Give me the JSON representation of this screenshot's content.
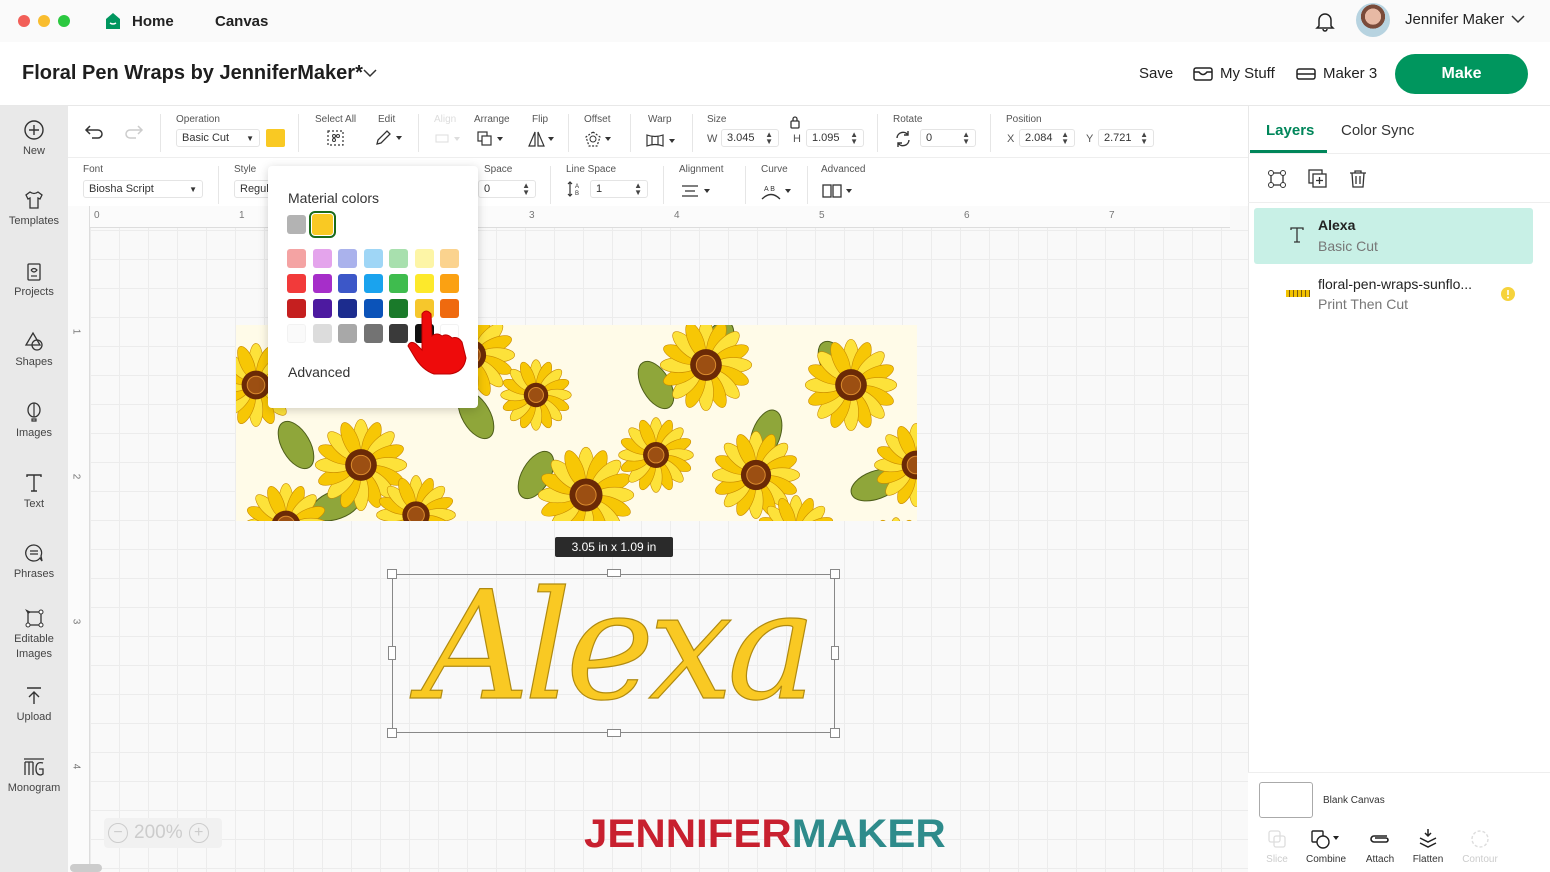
{
  "window": {
    "nav": {
      "home": "Home",
      "canvas": "Canvas"
    },
    "user": {
      "name": "Jennifer Maker"
    }
  },
  "header": {
    "project_title": "Floral Pen Wraps by JenniferMaker*",
    "save": "Save",
    "my_stuff": "My Stuff",
    "machine": "Maker 3",
    "make": "Make"
  },
  "sidebar": {
    "items": [
      {
        "label": "New",
        "icon": "plus-circle-icon"
      },
      {
        "label": "Templates",
        "icon": "shirt-icon"
      },
      {
        "label": "Projects",
        "icon": "projects-icon"
      },
      {
        "label": "Shapes",
        "icon": "shapes-icon"
      },
      {
        "label": "Images",
        "icon": "balloon-icon"
      },
      {
        "label": "Text",
        "icon": "text-icon"
      },
      {
        "label": "Phrases",
        "icon": "speech-bubble-icon"
      },
      {
        "label": "Editable Images",
        "icon": "editable-image-icon"
      },
      {
        "label": "Upload",
        "icon": "upload-icon"
      },
      {
        "label": "Monogram",
        "icon": "monogram-icon"
      }
    ]
  },
  "toolbar": {
    "operation": {
      "label": "Operation",
      "value": "Basic Cut",
      "color": "#f9c923"
    },
    "select_all": "Select All",
    "edit": "Edit",
    "align": "Align",
    "arrange": "Arrange",
    "flip": "Flip",
    "offset": "Offset",
    "warp": "Warp",
    "size": {
      "label": "Size",
      "w_label": "W",
      "w": "3.045",
      "h_label": "H",
      "h": "1.095"
    },
    "rotate": {
      "label": "Rotate",
      "value": "0"
    },
    "position": {
      "label": "Position",
      "x_label": "X",
      "x": "2.084",
      "y_label": "Y",
      "y": "2.721"
    }
  },
  "text_toolbar": {
    "font": {
      "label": "Font",
      "value": "Biosha Script"
    },
    "style": {
      "label": "Style",
      "value": "Regul"
    },
    "letter_space": {
      "label": "Space",
      "value": "0"
    },
    "line_space": {
      "label": "Line Space",
      "value": "1"
    },
    "alignment": "Alignment",
    "curve": "Curve",
    "advanced": "Advanced"
  },
  "rulers": {
    "top": [
      "0",
      "1",
      "2",
      "3",
      "4",
      "5",
      "6",
      "7"
    ],
    "left": [
      "1",
      "2",
      "3",
      "4"
    ]
  },
  "color_popover": {
    "title": "Material colors",
    "recent": [
      "#b3b3b3",
      "#f9c923"
    ],
    "selected": "#f9c923",
    "palette": [
      [
        "#f4a3a3",
        "#e4a4ec",
        "#aab2ec",
        "#9fd6f6",
        "#a8e0ae",
        "#fdf5a6",
        "#fbd38e"
      ],
      [
        "#f23a3a",
        "#a62ec9",
        "#3c57c8",
        "#1aa3ee",
        "#3fbc4e",
        "#fde92b",
        "#fba112"
      ],
      [
        "#c51f1f",
        "#4d1aa0",
        "#1c2c8e",
        "#0b53b9",
        "#1a7a2a",
        "#f6c72c",
        "#ef6a0f"
      ],
      [
        "#fafafa",
        "#dcdcdc",
        "#a8a8a8",
        "#737373",
        "#3a3a3a",
        "#111111",
        "#ffffff"
      ]
    ],
    "advanced": "Advanced"
  },
  "canvas": {
    "size_tooltip": "3.05  in x 1.09  in",
    "text_object": "Alexa",
    "text_color": "#f9c923",
    "zoom": "200%"
  },
  "watermark": {
    "part1": "JENNIFER",
    "part2": "MAKER",
    "color1": "#c8202f",
    "color2": "#2e8b8b"
  },
  "layers_panel": {
    "tabs": [
      "Layers",
      "Color Sync"
    ],
    "active_tab": "Layers",
    "layers": [
      {
        "name": "Alexa",
        "operation": "Basic Cut",
        "selected": true
      },
      {
        "name": "floral-pen-wraps-sunflo...",
        "operation": "Print Then Cut",
        "warning": true
      }
    ],
    "blank_canvas": "Blank Canvas",
    "actions": [
      {
        "label": "Slice",
        "enabled": false
      },
      {
        "label": "Combine",
        "enabled": true
      },
      {
        "label": "Attach",
        "enabled": true
      },
      {
        "label": "Flatten",
        "enabled": true
      },
      {
        "label": "Contour",
        "enabled": false
      }
    ]
  }
}
